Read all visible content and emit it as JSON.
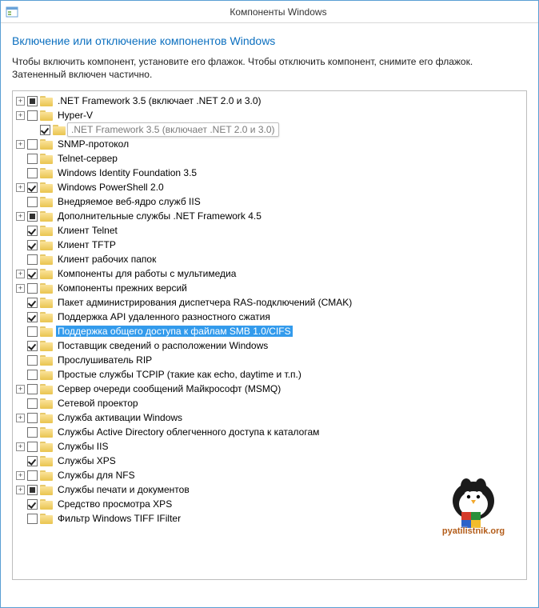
{
  "window": {
    "title": "Компоненты Windows"
  },
  "heading": "Включение или отключение компонентов Windows",
  "description": "Чтобы включить компонент, установите его флажок. Чтобы отключить компонент, снимите его флажок. Затененный включен частично.",
  "tooltip": ".NET Framework 3.5 (включает .NET 2.0 и 3.0)",
  "watermark": "pyatilistnik.org",
  "items": [
    {
      "expand": "plus",
      "check": "partial",
      "label": ".NET Framework 3.5 (включает .NET 2.0 и 3.0)",
      "indent": 0
    },
    {
      "expand": "plus",
      "check": "unchecked",
      "label": "Hyper-V",
      "indent": 0
    },
    {
      "expand": "blank",
      "check": "checked",
      "label": "",
      "indent": 1,
      "tooltip": true
    },
    {
      "expand": "plus",
      "check": "unchecked",
      "label": "SNMP-протокол",
      "indent": 0
    },
    {
      "expand": "blank",
      "check": "unchecked",
      "label": "Telnet-сервер",
      "indent": 0
    },
    {
      "expand": "blank",
      "check": "unchecked",
      "label": "Windows Identity Foundation 3.5",
      "indent": 0
    },
    {
      "expand": "plus",
      "check": "checked",
      "label": "Windows PowerShell 2.0",
      "indent": 0
    },
    {
      "expand": "blank",
      "check": "unchecked",
      "label": "Внедряемое веб-ядро служб IIS",
      "indent": 0
    },
    {
      "expand": "plus",
      "check": "partial",
      "label": "Дополнительные службы .NET Framework 4.5",
      "indent": 0
    },
    {
      "expand": "blank",
      "check": "checked",
      "label": "Клиент Telnet",
      "indent": 0
    },
    {
      "expand": "blank",
      "check": "checked",
      "label": "Клиент TFTP",
      "indent": 0
    },
    {
      "expand": "blank",
      "check": "unchecked",
      "label": "Клиент рабочих папок",
      "indent": 0
    },
    {
      "expand": "plus",
      "check": "checked",
      "label": "Компоненты для работы с мультимедиа",
      "indent": 0
    },
    {
      "expand": "plus",
      "check": "unchecked",
      "label": "Компоненты прежних версий",
      "indent": 0
    },
    {
      "expand": "blank",
      "check": "checked",
      "label": "Пакет администрирования диспетчера RAS-подключений (CMAK)",
      "indent": 0
    },
    {
      "expand": "blank",
      "check": "checked",
      "label": "Поддержка API удаленного разностного сжатия",
      "indent": 0
    },
    {
      "expand": "blank",
      "check": "unchecked",
      "label": "Поддержка общего доступа к файлам SMB 1.0/CIFS",
      "indent": 0,
      "selected": true
    },
    {
      "expand": "blank",
      "check": "checked",
      "label": "Поставщик сведений о расположении Windows",
      "indent": 0
    },
    {
      "expand": "blank",
      "check": "unchecked",
      "label": "Прослушиватель RIP",
      "indent": 0
    },
    {
      "expand": "blank",
      "check": "unchecked",
      "label": "Простые службы TCPIP (такие как echo, daytime и т.п.)",
      "indent": 0
    },
    {
      "expand": "plus",
      "check": "unchecked",
      "label": "Сервер очереди сообщений Майкрософт (MSMQ)",
      "indent": 0
    },
    {
      "expand": "blank",
      "check": "unchecked",
      "label": "Сетевой проектор",
      "indent": 0
    },
    {
      "expand": "plus",
      "check": "unchecked",
      "label": "Служба активации Windows",
      "indent": 0
    },
    {
      "expand": "blank",
      "check": "unchecked",
      "label": "Службы Active Directory облегченного доступа к каталогам",
      "indent": 0
    },
    {
      "expand": "plus",
      "check": "unchecked",
      "label": "Службы IIS",
      "indent": 0
    },
    {
      "expand": "blank",
      "check": "checked",
      "label": "Службы XPS",
      "indent": 0
    },
    {
      "expand": "plus",
      "check": "unchecked",
      "label": "Службы для NFS",
      "indent": 0
    },
    {
      "expand": "plus",
      "check": "partial",
      "label": "Службы печати и документов",
      "indent": 0
    },
    {
      "expand": "blank",
      "check": "checked",
      "label": "Средство просмотра XPS",
      "indent": 0
    },
    {
      "expand": "blank",
      "check": "unchecked",
      "label": "Фильтр Windows TIFF IFilter",
      "indent": 0
    }
  ]
}
